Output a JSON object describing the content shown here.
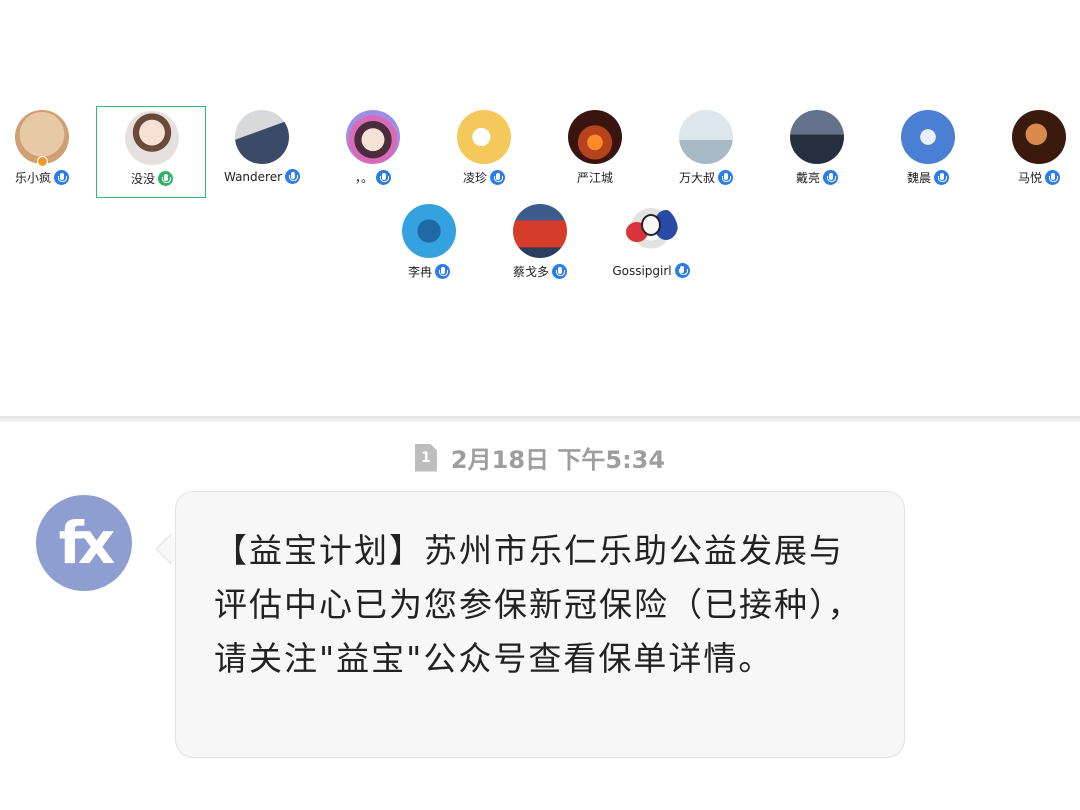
{
  "participants": [
    {
      "name": "乐小疯",
      "mic": "on"
    },
    {
      "name": "没没",
      "mic": "speaking"
    },
    {
      "name": "Wanderer",
      "mic": "on"
    },
    {
      "name": "，。",
      "mic": "on"
    },
    {
      "name": "凌珍",
      "mic": "on"
    },
    {
      "name": "严江城",
      "mic": "none"
    },
    {
      "name": "万大叔",
      "mic": "on"
    },
    {
      "name": "戴亮",
      "mic": "on"
    },
    {
      "name": "魏晨",
      "mic": "on"
    },
    {
      "name": "马悦",
      "mic": "on"
    },
    {
      "name": "李冉",
      "mic": "on"
    },
    {
      "name": "蔡戈多",
      "mic": "on"
    },
    {
      "name": "Gossipgirl",
      "mic": "on"
    }
  ],
  "message": {
    "sim_slot": "1",
    "timestamp": "2月18日 下午5:34",
    "sender_avatar_text": "fx",
    "text": "【益宝计划】苏州市乐仁乐助公益发展与评估中心已为您参保新冠保险（已接种），请关注\"益宝\"公众号查看保单详情。"
  },
  "colors": {
    "accent_active": "#2dbd6e",
    "mic_blue": "#2b7de9",
    "mic_green": "#2fb46a",
    "bubble_bg": "#f7f7f7",
    "timestamp": "#9e9e9e"
  }
}
